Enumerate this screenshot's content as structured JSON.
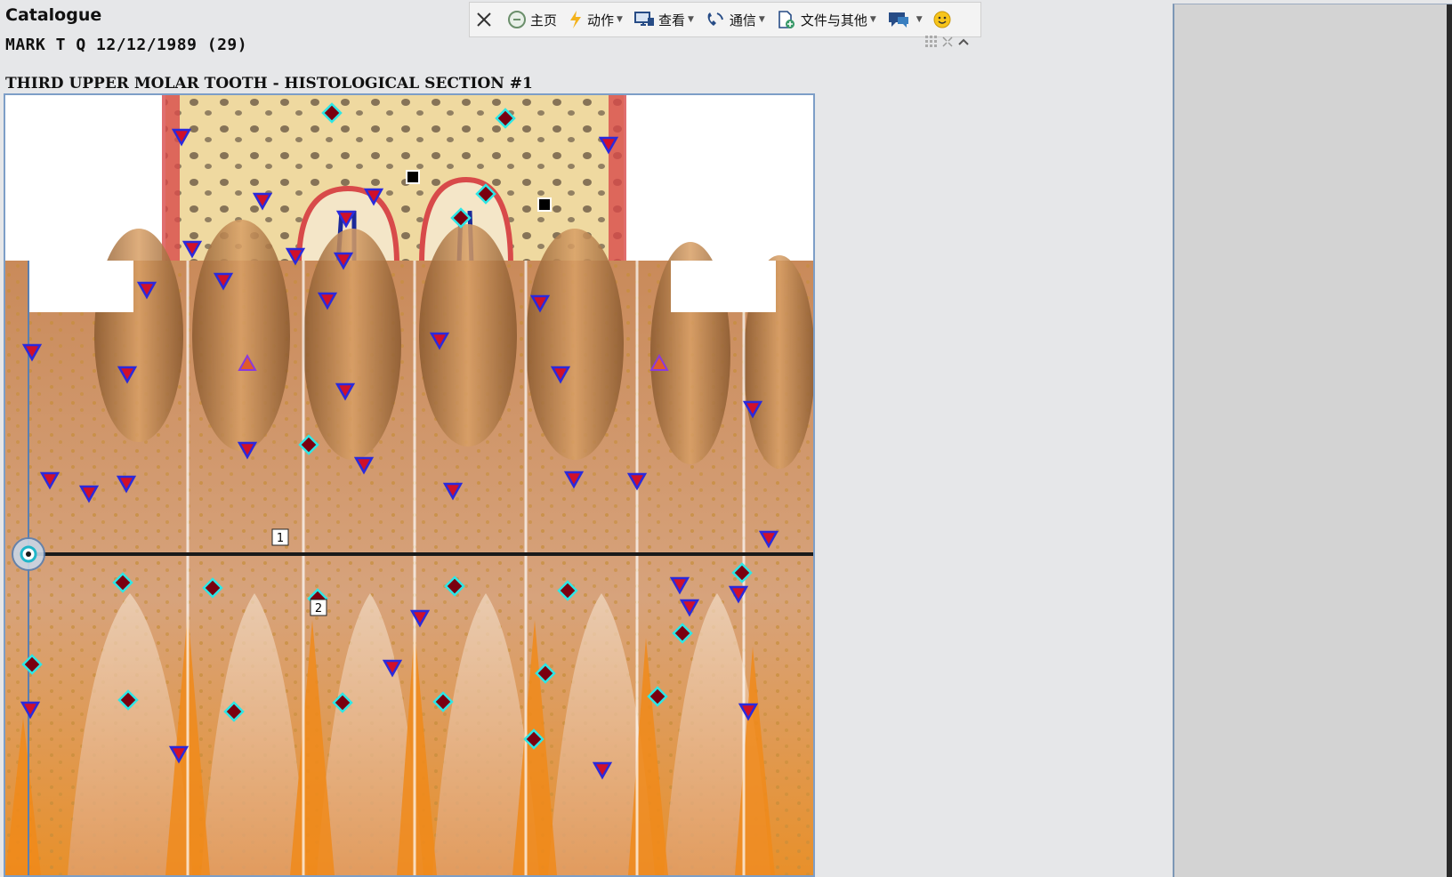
{
  "header": {
    "title": "Catalogue",
    "patient": "MARK T Q 12/12/1989 (29)",
    "section_title": "THIRD UPPER MOLAR TOOTH - HISTOLOGICAL SECTION #1"
  },
  "toolbar": {
    "close_label": "",
    "items": [
      {
        "label": "主页",
        "icon": "home-icon",
        "dropdown": false
      },
      {
        "label": "动作",
        "icon": "lightning-icon",
        "dropdown": true
      },
      {
        "label": "查看",
        "icon": "monitor-icon",
        "dropdown": true
      },
      {
        "label": "通信",
        "icon": "phone-icon",
        "dropdown": true
      },
      {
        "label": "文件与其他",
        "icon": "file-plus-icon",
        "dropdown": true
      },
      {
        "label": "",
        "icon": "chat-icon",
        "dropdown": true
      },
      {
        "label": "",
        "icon": "smiley-icon",
        "dropdown": false
      }
    ]
  },
  "viewer": {
    "markers": {
      "label_1": "1",
      "label_2": "2"
    }
  },
  "colors": {
    "accent": "#7d9ec7",
    "marker_red": "#d0102a",
    "marker_blue": "#2a2adc",
    "diamond_fill": "#7a0010",
    "diamond_stroke": "#2ee6e6"
  }
}
